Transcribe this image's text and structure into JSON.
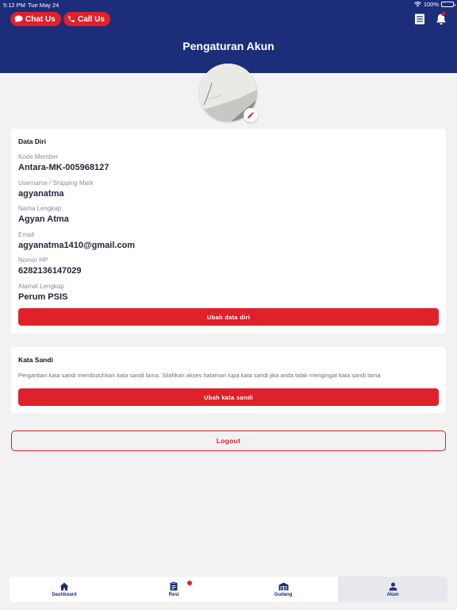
{
  "status_bar": {
    "time": "5:12 PM",
    "date": "Tue May 24",
    "battery": "100%"
  },
  "header": {
    "chat_label": "Chat Us",
    "call_label": "Call Us",
    "title": "Pengaturan Akun",
    "brand_color": "#1c2d7a",
    "accent_color": "#e0202a"
  },
  "data_diri": {
    "title": "Data Diri",
    "fields": [
      {
        "label": "Kode Member",
        "value": "Antara-MK-005968127"
      },
      {
        "label": "Username / Shipping Mark",
        "value": "agyanatma"
      },
      {
        "label": "Nama Lengkap",
        "value": "Agyan Atma"
      },
      {
        "label": "Email",
        "value": "agyanatma1410@gmail.com"
      },
      {
        "label": "Nomor HP",
        "value": "6282136147029"
      },
      {
        "label": "Alamat Lengkap",
        "value": "Perum PSIS"
      }
    ],
    "button_label": "Ubah data diri"
  },
  "kata_sandi": {
    "title": "Kata Sandi",
    "description": "Pergantian kata sandi membutuhkan kata sandi lama. Silahkan akses halaman lupa kata sandi jika anda tidak mengingat kata sandi lama",
    "button_label": "Ubah kata sandi"
  },
  "logout_label": "Logout",
  "bottom_nav": {
    "items": [
      {
        "label": "Dashboard",
        "icon": "home-icon"
      },
      {
        "label": "Resi",
        "icon": "clipboard-icon"
      },
      {
        "label": "Gudang",
        "icon": "warehouse-icon"
      },
      {
        "label": "Akun",
        "icon": "person-icon"
      }
    ],
    "active": "Akun"
  }
}
